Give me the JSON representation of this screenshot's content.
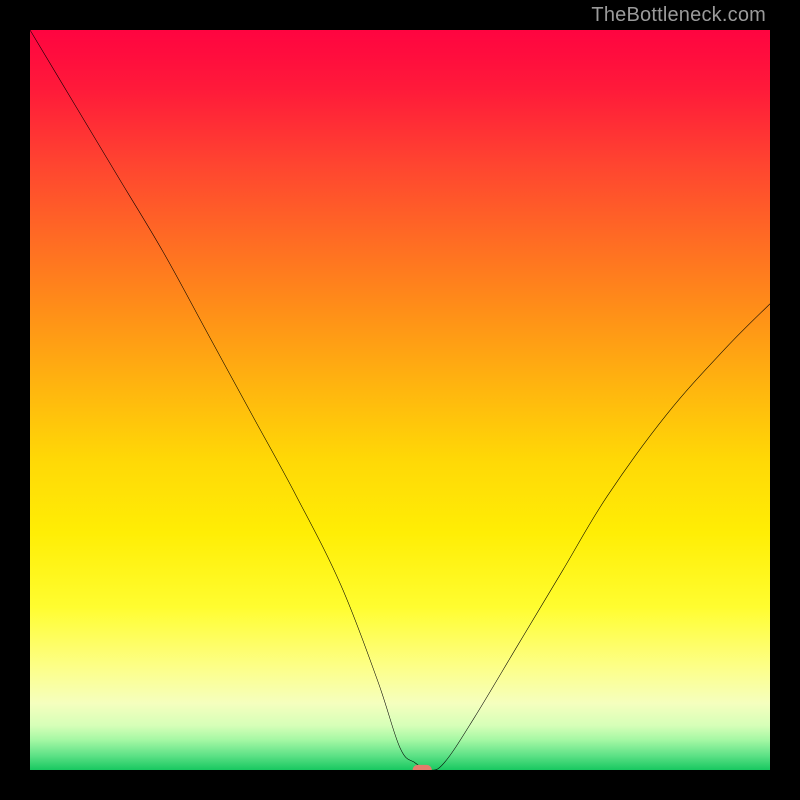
{
  "watermark": "TheBottleneck.com",
  "chart_data": {
    "type": "line",
    "title": "",
    "xlabel": "",
    "ylabel": "",
    "xlim": [
      0,
      100
    ],
    "ylim": [
      0,
      100
    ],
    "gradient_colors": {
      "top": "#ff0440",
      "upper_mid": "#ff8f18",
      "mid": "#ffee05",
      "lower_mid": "#f5ffbe",
      "bottom": "#18c860"
    },
    "series": [
      {
        "name": "bottleneck-curve",
        "x": [
          0,
          6,
          12,
          18,
          24,
          30,
          36,
          42,
          47,
          50,
          52,
          54,
          56,
          60,
          66,
          72,
          78,
          86,
          94,
          100
        ],
        "y": [
          100,
          90,
          80,
          70,
          59,
          48,
          37,
          25,
          12,
          3,
          1,
          0,
          1,
          7,
          17,
          27,
          37,
          48,
          57,
          63
        ]
      }
    ],
    "min_marker": {
      "x": 53,
      "y": 0,
      "color": "#e47c6b"
    },
    "note": "Axes have no visible tick labels in the source image; values are normalized 0-100 estimates read from curve geometry."
  }
}
